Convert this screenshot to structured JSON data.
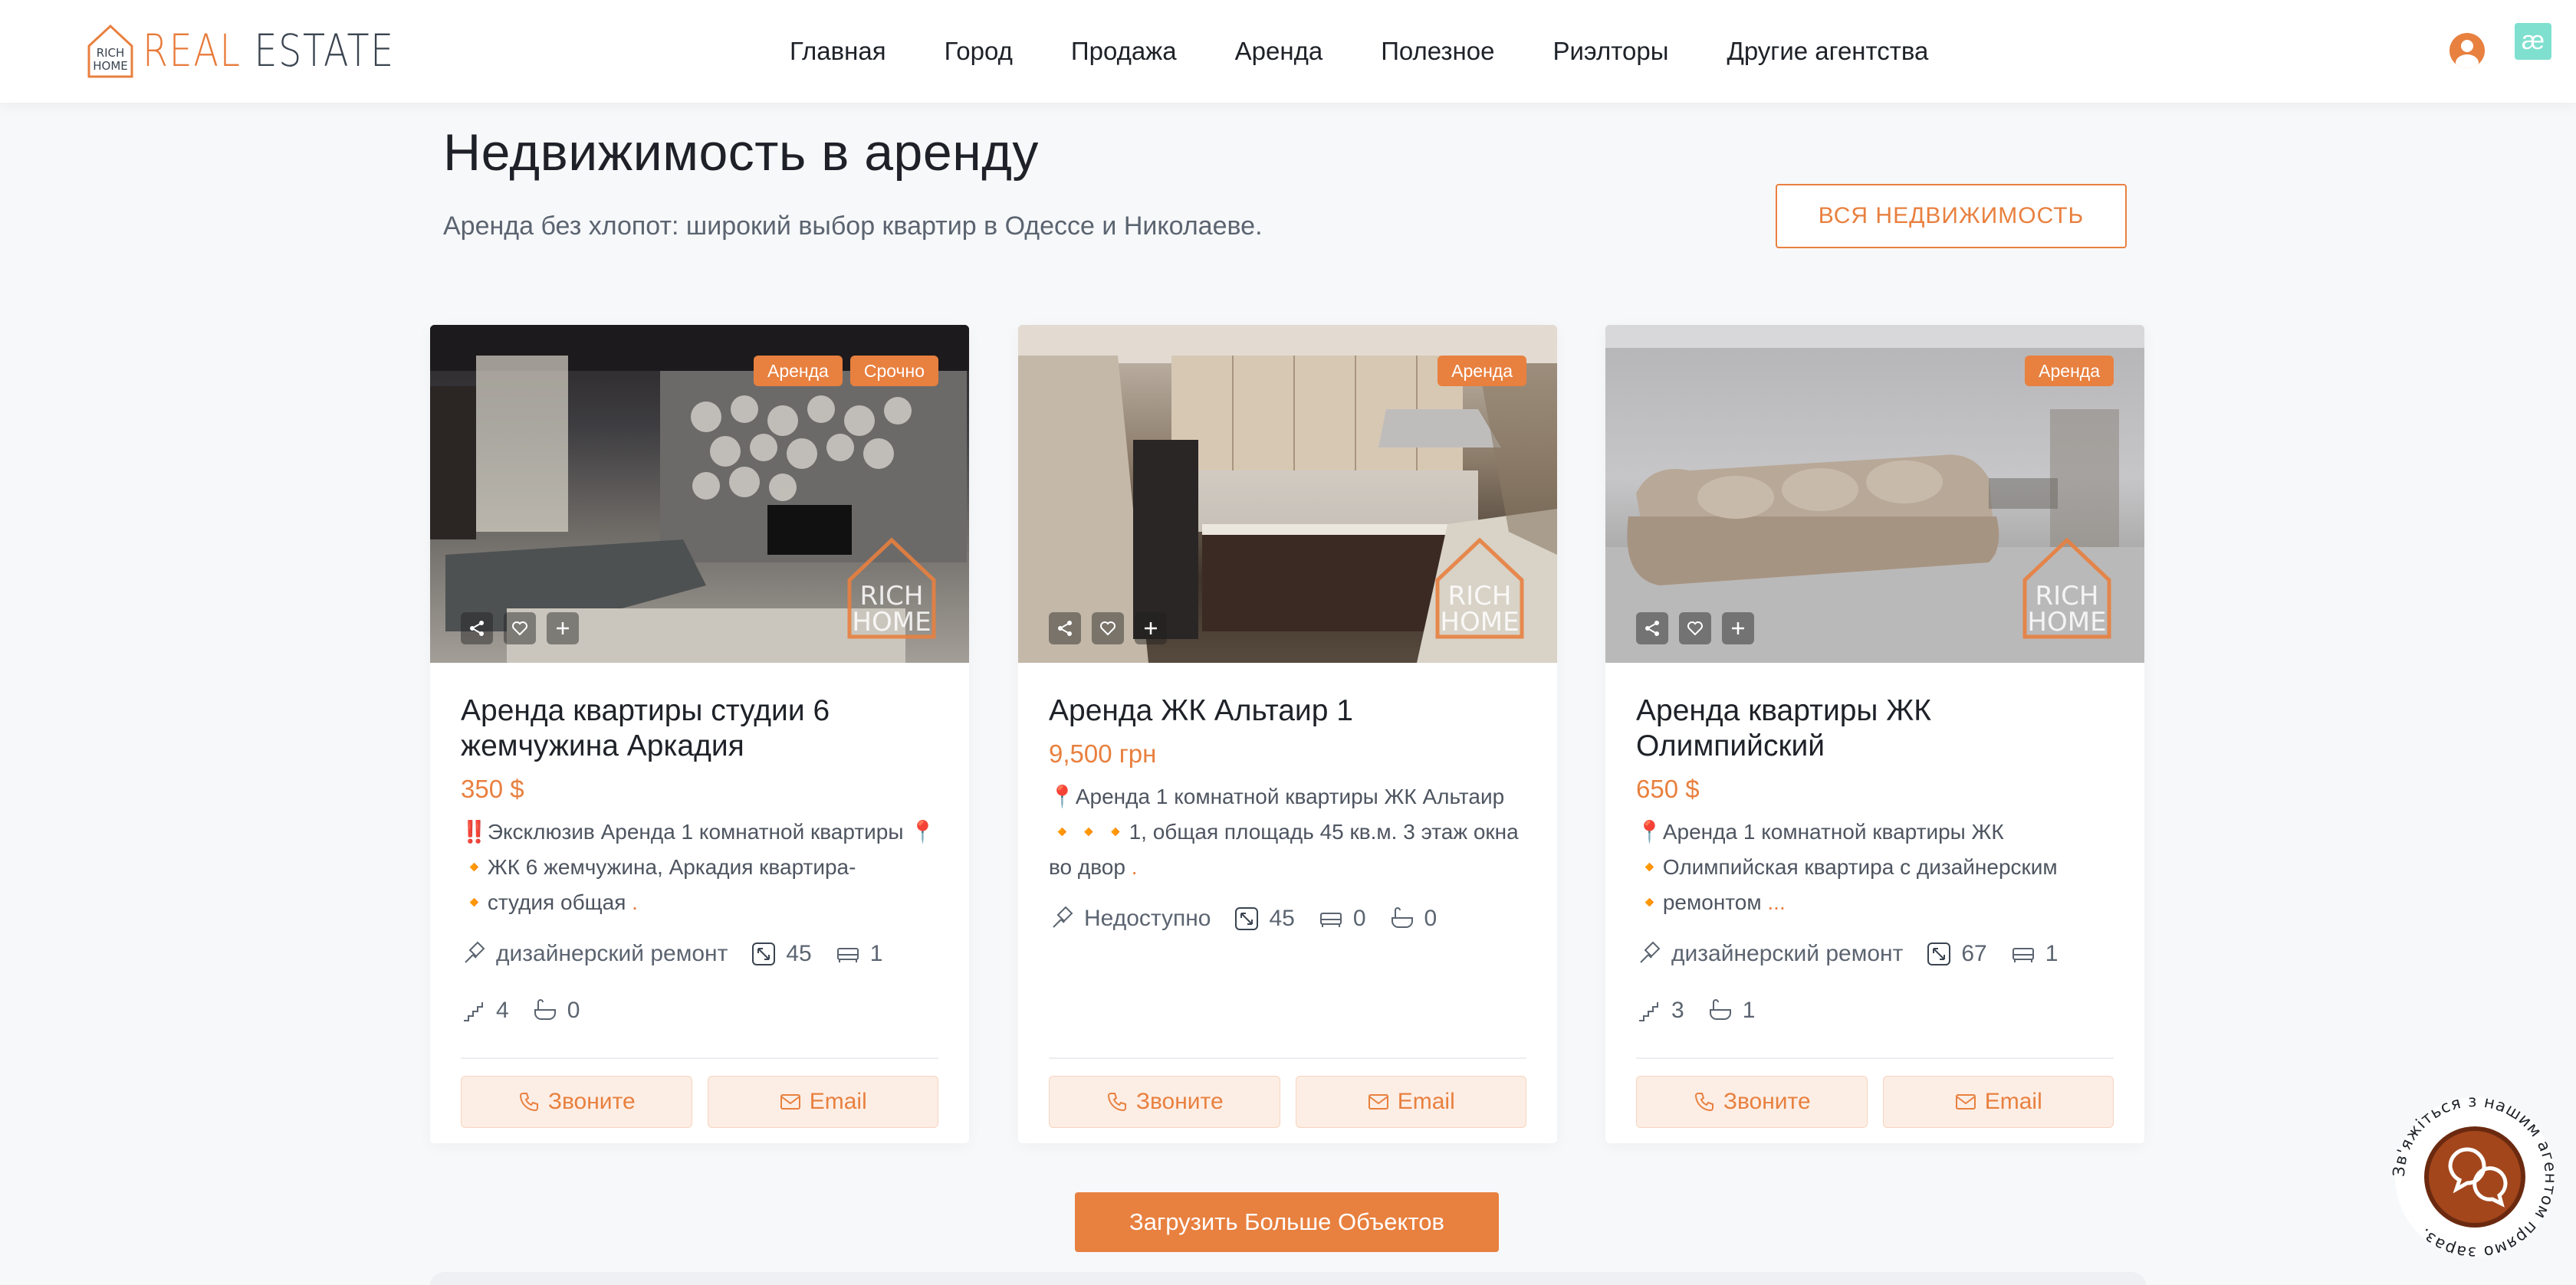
{
  "header": {
    "logo_small_top": "RICH",
    "logo_small_bottom": "HOME",
    "logo_word_1": "REAL",
    "logo_word_2": "ESTATE",
    "nav": [
      "Главная",
      "Город",
      "Продажа",
      "Аренда",
      "Полезное",
      "Риэлторы",
      "Другие агентства"
    ],
    "ae_label": "æ"
  },
  "section": {
    "title": "Недвижимость в аренду",
    "subtitle": "Аренда без хлопот: широкий выбор квартир в Одессе и Николаеве.",
    "all_button": "ВСЯ НЕДВИЖИМОСТЬ"
  },
  "watermark": {
    "top": "RICH",
    "bottom": "HOME"
  },
  "cards": [
    {
      "badges": [
        "Аренда",
        "Срочно"
      ],
      "title": "Аренда квартиры студии 6 жемчужина Аркадия",
      "price": "350 $",
      "desc": "‼️Эксклюзив Аренда 1 комнатной квартиры 📍🔸ЖК 6 жемчужина, Аркадия квартира-🔸студия общая",
      "desc_more": ".",
      "features": [
        {
          "icon": "renovation-icon",
          "value": "дизайнерский ремонт"
        },
        {
          "icon": "area-icon",
          "value": "45"
        },
        {
          "icon": "bed-icon",
          "value": "1"
        },
        {
          "icon": "stairs-icon",
          "value": "4"
        },
        {
          "icon": "bath-icon",
          "value": "0"
        }
      ],
      "call": "Звоните",
      "email": "Email"
    },
    {
      "badges": [
        "Аренда"
      ],
      "title": "Аренда ЖК Альтаир 1",
      "price": "9,500 грн",
      "desc": "📍Аренда 1 комнатной квартиры ЖК Альтаир 🔸🔸🔸1, общая площадь 45 кв.м. 3 этаж окна во двор",
      "desc_more": ".",
      "features": [
        {
          "icon": "renovation-icon",
          "value": "Недоступно"
        },
        {
          "icon": "area-icon",
          "value": "45"
        },
        {
          "icon": "bed-icon",
          "value": "0"
        },
        {
          "icon": "bath-icon",
          "value": "0"
        }
      ],
      "call": "Звоните",
      "email": "Email"
    },
    {
      "badges": [
        "Аренда"
      ],
      "title": "Аренда квартиры ЖК Олимпийский",
      "price": "650 $",
      "desc": "📍Аренда 1 комнатной квартиры ЖК 🔸Олимпийская квартира с дизайнерским 🔸ремонтом",
      "desc_more": "...",
      "features": [
        {
          "icon": "renovation-icon",
          "value": "дизайнерский ремонт"
        },
        {
          "icon": "area-icon",
          "value": "67"
        },
        {
          "icon": "bed-icon",
          "value": "1"
        },
        {
          "icon": "stairs-icon",
          "value": "3"
        },
        {
          "icon": "bath-icon",
          "value": "1"
        }
      ],
      "call": "Звоните",
      "email": "Email"
    }
  ],
  "load_more": "Загрузить Больше Объектов",
  "chat_widget": {
    "ring_text": "Зв'яжіться з нашим агентом прямо зараз. "
  },
  "colors": {
    "accent": "#e8803f",
    "text": "#1e2228",
    "muted": "#5b6470"
  }
}
